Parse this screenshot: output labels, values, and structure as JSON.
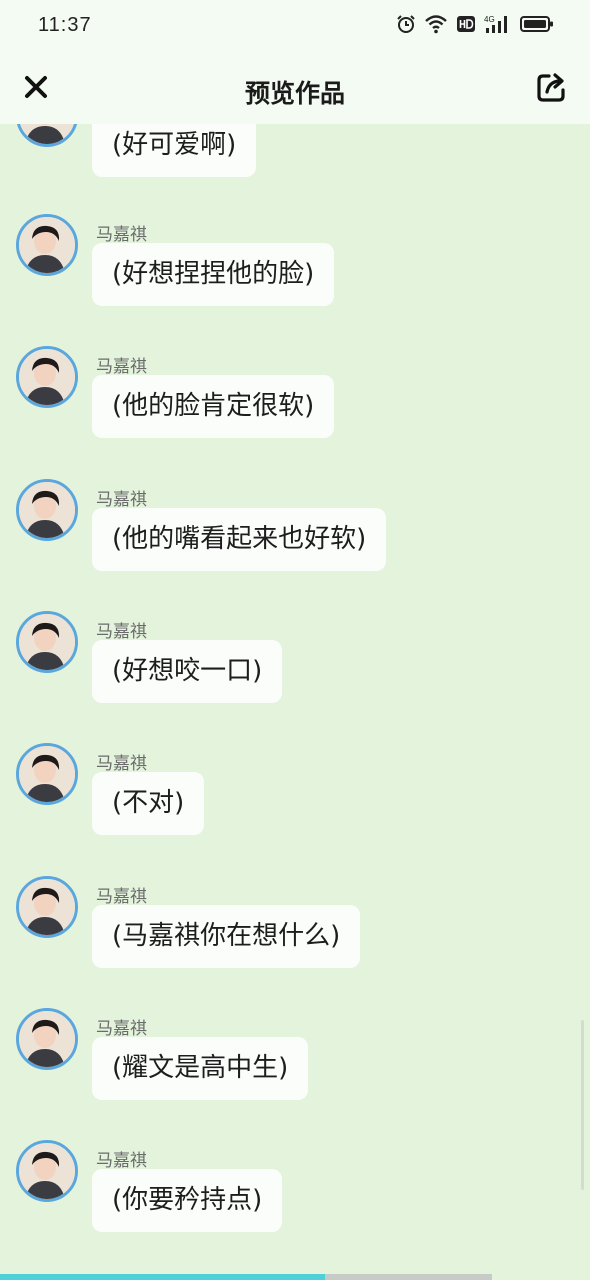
{
  "status_bar": {
    "time": "11:37",
    "icons": [
      "alarm-icon",
      "wifi-icon",
      "hd-icon",
      "signal-4g-icon",
      "battery-icon"
    ]
  },
  "header": {
    "title": "预览作品",
    "close_icon": "close-icon",
    "share_icon": "share-icon"
  },
  "messages": [
    {
      "sender": "",
      "text": "(好可爱啊)"
    },
    {
      "sender": "马嘉祺",
      "text": "(好想捏捏他的脸)"
    },
    {
      "sender": "马嘉祺",
      "text": "(他的脸肯定很软)"
    },
    {
      "sender": "马嘉祺",
      "text": "(他的嘴看起来也好软)"
    },
    {
      "sender": "马嘉祺",
      "text": "(好想咬一口)"
    },
    {
      "sender": "马嘉祺",
      "text": "(不对)"
    },
    {
      "sender": "马嘉祺",
      "text": "(马嘉祺你在想什么)"
    },
    {
      "sender": "马嘉祺",
      "text": "(耀文是高中生)"
    },
    {
      "sender": "马嘉祺",
      "text": "(你要矜持点)"
    }
  ],
  "progress": {
    "fraction": 0.66
  },
  "colors": {
    "background": "#e3f3dc",
    "header_bg": "#f4fbf2",
    "bubble": "#fbfdfb",
    "avatar_ring": "#5aa7de",
    "progress": "#4fd0d8"
  }
}
